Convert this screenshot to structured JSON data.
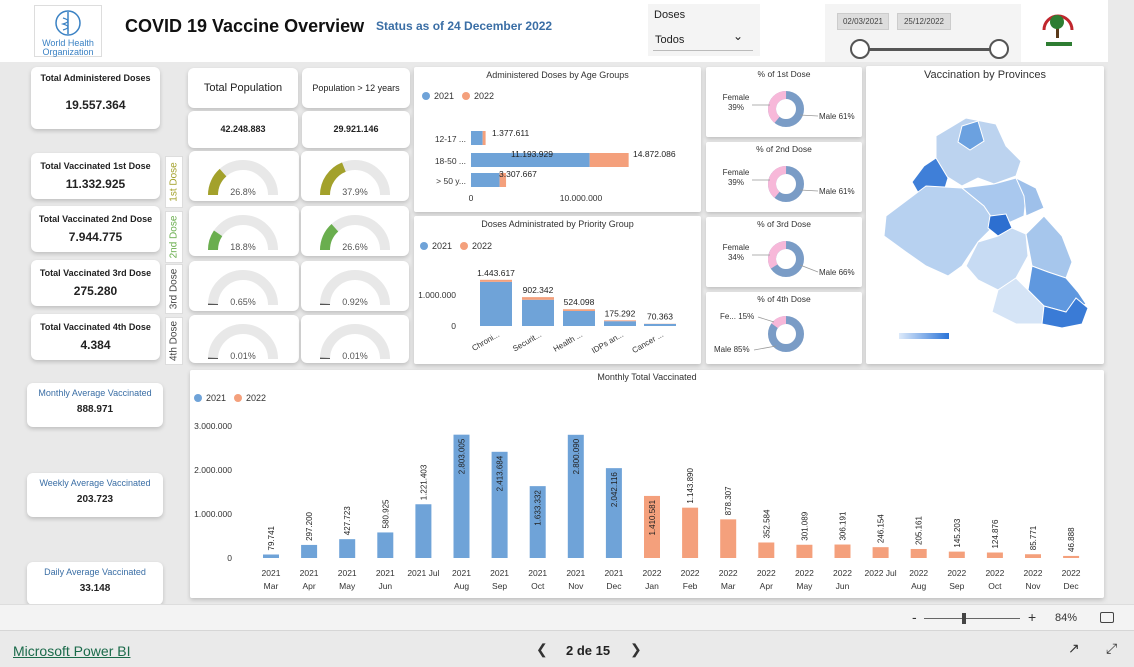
{
  "header": {
    "who_line1": "World Health",
    "who_line2": "Organization",
    "title": "COVID 19 Vaccine Overview",
    "status": "Status as of 24 December 2022",
    "doses_label": "Doses",
    "doses_value": "Todos",
    "date_start": "02/03/2021",
    "date_end": "25/12/2022"
  },
  "kpis": {
    "total_admin_label": "Total Administered Doses",
    "total_admin_value": "19.557.364",
    "total_pop_label": "Total Population",
    "total_pop_value": "42.248.883",
    "pop12_label": "Population > 12 years",
    "pop12_value": "29.921.146",
    "dose1_label": "Total Vaccinated 1st Dose",
    "dose1_value": "11.332.925",
    "dose2_label": "Total Vaccinated 2nd Dose",
    "dose2_value": "7.944.775",
    "dose3_label": "Total Vaccinated 3rd Dose",
    "dose3_value": "275.280",
    "dose4_label": "Total Vaccinated 4th Dose",
    "dose4_value": "4.384",
    "tab1": "1st Dose",
    "tab2": "2nd Dose",
    "tab3": "3rd Dose",
    "tab4": "4th Dose",
    "monthly_label": "Monthly Average Vaccinated",
    "monthly_value": "888.971",
    "weekly_label": "Weekly Average Vaccinated",
    "weekly_value": "203.723",
    "daily_label": "Daily Average Vaccinated",
    "daily_value": "33.148"
  },
  "gauges": [
    {
      "pct": 26.8,
      "label": "26.8%",
      "color": "#a3a12b"
    },
    {
      "pct": 37.9,
      "label": "37.9%",
      "color": "#a3a12b"
    },
    {
      "pct": 18.8,
      "label": "18.8%",
      "color": "#6aae4e"
    },
    {
      "pct": 26.6,
      "label": "26.6%",
      "color": "#6aae4e"
    },
    {
      "pct": 0.65,
      "label": "0.65%",
      "color": "#555555"
    },
    {
      "pct": 0.92,
      "label": "0.92%",
      "color": "#555555"
    },
    {
      "pct": 0.01,
      "label": "0.01%",
      "color": "#555555"
    },
    {
      "pct": 0.01,
      "label": "0.01%",
      "color": "#555555"
    }
  ],
  "donuts": [
    {
      "title": "% of 1st Dose",
      "female": "Female",
      "female_pct": "39%",
      "male": "Male 61%",
      "female_value": 39
    },
    {
      "title": "% of 2nd Dose",
      "female": "Female",
      "female_pct": "39%",
      "male": "Male 61%",
      "female_value": 39
    },
    {
      "title": "% of 3rd Dose",
      "female": "Female",
      "female_pct": "34%",
      "male": "Male 66%",
      "female_value": 34
    },
    {
      "title": "% of 4th Dose",
      "female": "Fe... 15%",
      "female_pct": "",
      "male": "Male 85%",
      "female_value": 15
    }
  ],
  "map": {
    "title": "Vaccination by Provinces"
  },
  "colors": {
    "y2021": "#6fa3d8",
    "y2022": "#f4a07c",
    "female": "#f7b8d9",
    "male": "#7a9cc6"
  },
  "legend": {
    "y2021": "2021",
    "y2022": "2022"
  },
  "charts": {
    "age": {
      "title": "Administered Doses by Age Groups",
      "type": "bar",
      "categories": [
        "12-17 ...",
        "18-50 ...",
        "> 50 y..."
      ],
      "series": [
        {
          "name": "2021",
          "values": [
            1100000,
            11193929,
            2700000
          ]
        },
        {
          "name": "2022",
          "values": [
            277611,
            3678157,
            607667
          ]
        }
      ],
      "labels": [
        "1.377.611",
        "11.193.929",
        "14.872.086",
        "3.307.667"
      ],
      "xticks": [
        "0",
        "10.000.000"
      ]
    },
    "priority": {
      "title": "Doses Administrated by Priority Group",
      "type": "bar",
      "categories": [
        "Chroni...",
        "Securit...",
        "Health ...",
        "IDPs an...",
        "Cancer ..."
      ],
      "series": [
        {
          "name": "2021",
          "values": [
            1380000,
            820000,
            470000,
            150000,
            65000
          ]
        },
        {
          "name": "2022",
          "values": [
            63617,
            82342,
            54098,
            25292,
            5363
          ]
        }
      ],
      "labels": [
        "1.443.617",
        "902.342",
        "524.098",
        "175.292",
        "70.363"
      ],
      "yticks": [
        "1.000.000",
        "0"
      ]
    },
    "monthly": {
      "title": "Monthly Total Vaccinated",
      "type": "bar",
      "categories": [
        "2021 Mar",
        "2021 Apr",
        "2021 May",
        "2021 Jun",
        "2021 Jul",
        "2021 Aug",
        "2021 Sep",
        "2021 Oct",
        "2021 Nov",
        "2021 Dec",
        "2022 Jan",
        "2022 Feb",
        "2022 Mar",
        "2022 Apr",
        "2022 May",
        "2022 Jun",
        "2022 Jul",
        "2022 Aug",
        "2022 Sep",
        "2022 Oct",
        "2022 Nov",
        "2022 Dec"
      ],
      "x_top": [
        "2021",
        "2021",
        "2021",
        "2021",
        "2021 Jul",
        "2021",
        "2021",
        "2021",
        "2021",
        "2021",
        "2022",
        "2022",
        "2022",
        "2022",
        "2022",
        "2022",
        "2022 Jul",
        "2022",
        "2022",
        "2022",
        "2022",
        "2022"
      ],
      "x_bottom": [
        "Mar",
        "Apr",
        "May",
        "Jun",
        "",
        "Aug",
        "Sep",
        "Oct",
        "Nov",
        "Dec",
        "Jan",
        "Feb",
        "Mar",
        "Apr",
        "May",
        "Jun",
        "",
        "Aug",
        "Sep",
        "Oct",
        "Nov",
        "Dec"
      ],
      "values": [
        79741,
        297200,
        427723,
        580925,
        1221403,
        2803005,
        2413684,
        1633332,
        2800090,
        2042116,
        1410581,
        1143890,
        878307,
        352584,
        301089,
        306191,
        246154,
        205161,
        145203,
        124876,
        85771,
        46888
      ],
      "labels": [
        "79.741",
        "297.200",
        "427.723",
        "580.925",
        "1.221.403",
        "2.803.005",
        "2.413.684",
        "1.633.332",
        "2.800.090",
        "2.042.116",
        "1.410.581",
        "1.143.890",
        "878.307",
        "352.584",
        "301.089",
        "306.191",
        "246.154",
        "205.161",
        "145.203",
        "124.876",
        "85.771",
        "46.888"
      ],
      "yticks": [
        "3.000.000",
        "2.000.000",
        "1.000.000",
        "0"
      ],
      "ylim": [
        0,
        3000000
      ]
    }
  },
  "footer": {
    "zoom": "84%",
    "brand": "Microsoft Power BI",
    "page": "2 de 15"
  }
}
